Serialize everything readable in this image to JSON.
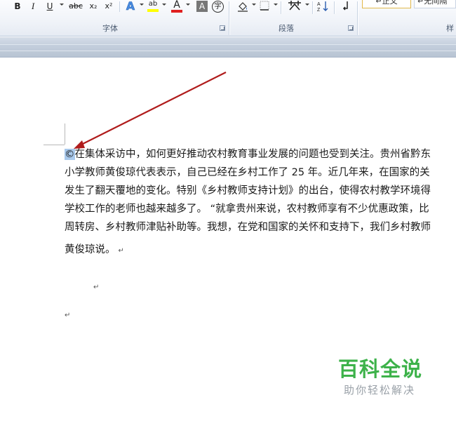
{
  "ribbon": {
    "font_group": {
      "label": "字体",
      "bold": "B",
      "italic": "I",
      "underline": "U",
      "strikethrough": "abc",
      "subscript": "x₂",
      "superscript": "x²",
      "text_effect": "A",
      "highlight": "ab",
      "font_color": "A",
      "char_shading": "A",
      "enclose_char": "字"
    },
    "paragraph_group": {
      "label": "段落"
    },
    "styles_group": {
      "label": "样",
      "normal_style": "↵正文",
      "no_spacing_style": "↵无间隔"
    }
  },
  "document": {
    "selected_symbol": "©",
    "lines": [
      "在集体采访中，如何更好推动农村教育事业发展的问题也受到关注。贵州省黔东",
      "小学教师黄俊琼代表表示，自己已经在乡村工作了 25 年。近几年来，在国家的关",
      "发生了翻天覆地的变化。特别《乡村教师支持计划》的出台，使得农村教学环境得",
      "学校工作的老师也越来越多了。 “就拿贵州来说，农村教师享有不少优惠政策，比",
      "周转房、乡村教师津贴补助等。我想，在党和国家的关怀和支持下，我们乡村教师",
      "黄俊琼说。"
    ],
    "paragraph_mark": "↵"
  },
  "watermark": {
    "title": "百科全说",
    "subtitle": "助你轻松解决"
  },
  "colors": {
    "arrow": "#b01c1c",
    "selection": "#a9c9ec",
    "watermark_green": "#3db24a",
    "font_color_bar": "#e02020",
    "highlight_bar": "#ffff00"
  }
}
